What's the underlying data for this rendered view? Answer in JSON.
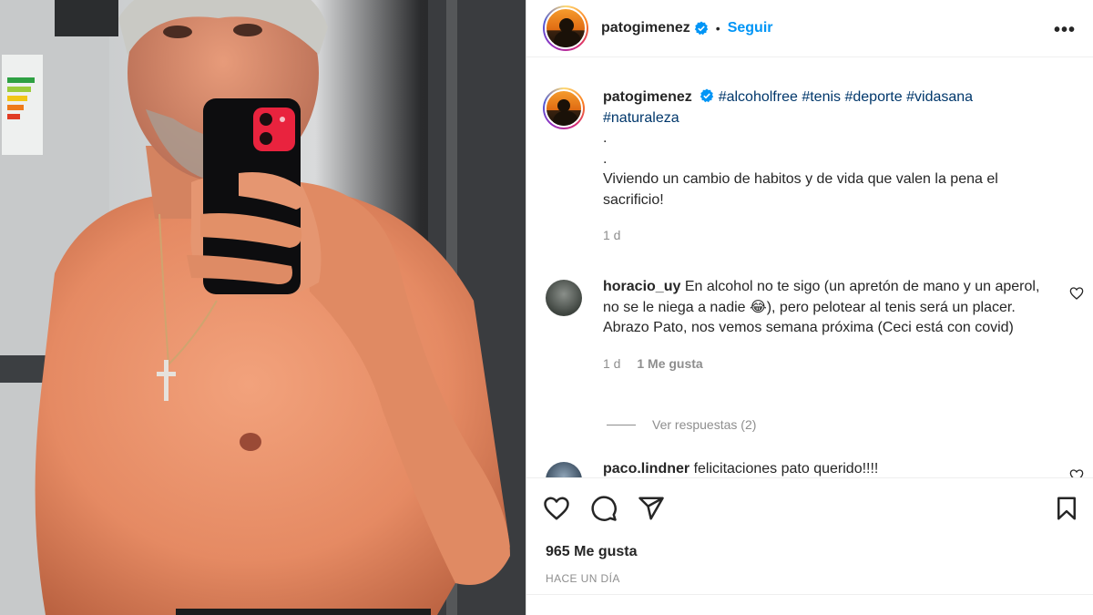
{
  "post": {
    "username": "patogimenez",
    "separator": "•",
    "follow_label": "Seguir",
    "more_label": "•••",
    "caption": {
      "hashtags": [
        "#alcoholfree",
        "#tenis",
        "#deporte",
        "#vidasana",
        "#naturaleza"
      ],
      "line1": ".",
      "line2": ".",
      "text": "Viviendo un cambio de habitos y de vida que valen la pena el sacrificio!",
      "age": "1 d"
    },
    "comments": [
      {
        "username": "horacio_uy",
        "text": "En alcohol no te sigo (un apretón de mano y un aperol, no se le niega a nadie 😂), pero pelotear al tenis será un placer. Abrazo Pato, nos vemos semana próxima (Ceci está con covid)",
        "age": "1 d",
        "likes": "1 Me gusta",
        "replies": "Ver respuestas (2)"
      },
      {
        "username": "paco.lindner",
        "text": "felicitaciones pato querido!!!!"
      }
    ],
    "likes_count": "965 Me gusta",
    "timestamp": "HACE UN DÍA"
  },
  "colors": {
    "accent": "#0095f6",
    "hashtag": "#00376b",
    "muted": "#8e8e8e",
    "text": "#262626"
  },
  "icons": [
    "verified-badge-icon",
    "more-options-icon",
    "heart-icon",
    "comment-icon",
    "share-icon",
    "bookmark-icon"
  ]
}
